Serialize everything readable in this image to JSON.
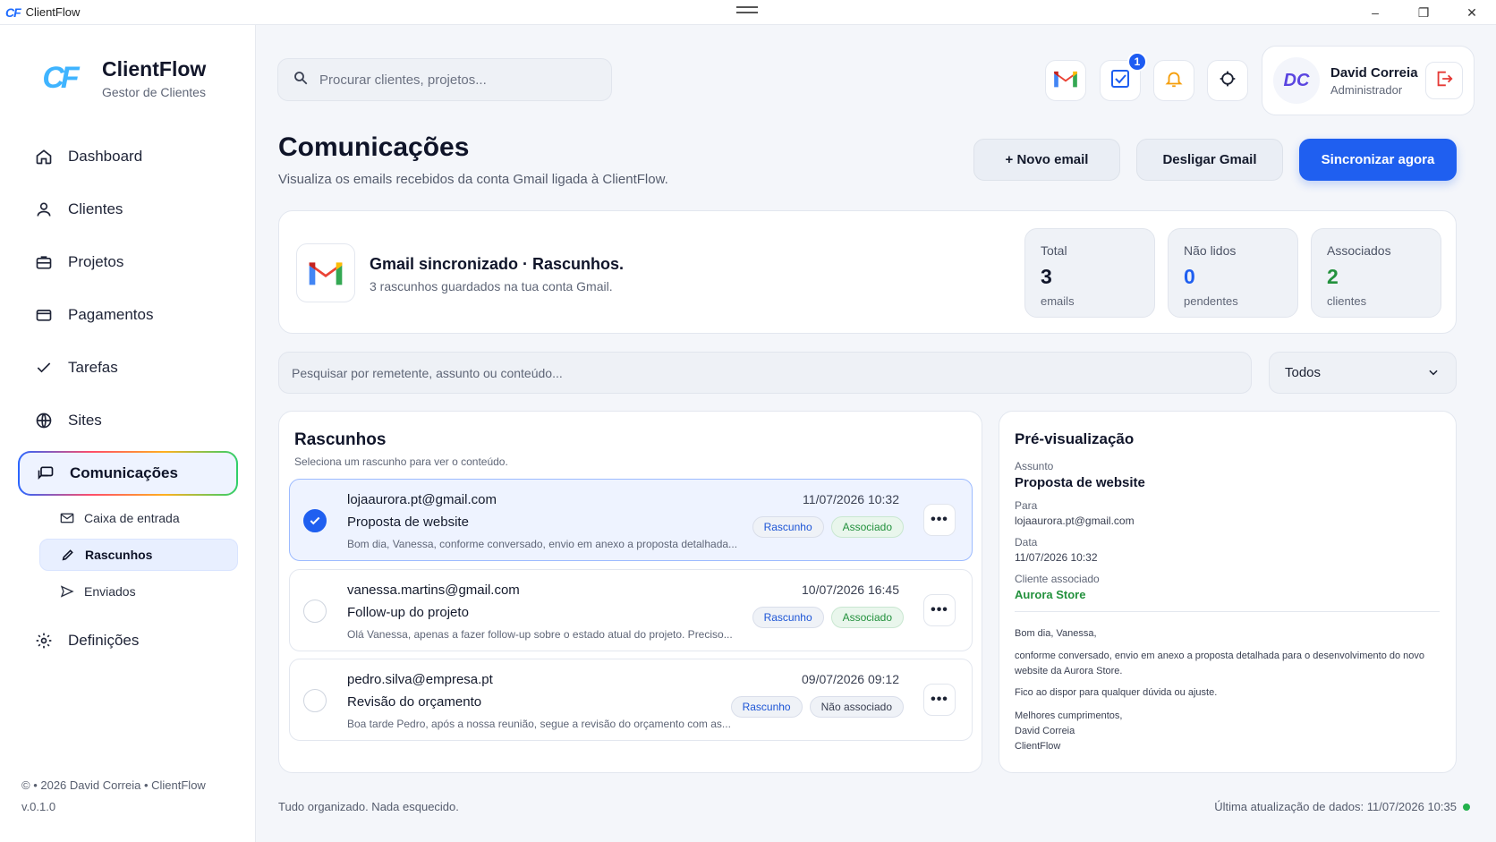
{
  "window": {
    "title": "ClientFlow",
    "logo_mark": "CF",
    "controls": {
      "minimize": "–",
      "maximize": "❐",
      "close": "✕"
    }
  },
  "brand": {
    "mark": "CF",
    "name": "ClientFlow",
    "subtitle": "Gestor de Clientes"
  },
  "sidebar": {
    "items": [
      {
        "label": "Dashboard",
        "icon": "home-icon"
      },
      {
        "label": "Clientes",
        "icon": "user-icon"
      },
      {
        "label": "Projetos",
        "icon": "briefcase-icon"
      },
      {
        "label": "Pagamentos",
        "icon": "wallet-icon"
      },
      {
        "label": "Tarefas",
        "icon": "check-icon"
      },
      {
        "label": "Sites",
        "icon": "globe-icon"
      },
      {
        "label": "Comunicações",
        "icon": "chat-icon",
        "active": true
      },
      {
        "label": "Definições",
        "icon": "gear-icon"
      }
    ],
    "subitems": [
      {
        "label": "Caixa de entrada",
        "icon": "mail-icon"
      },
      {
        "label": "Rascunhos",
        "icon": "pencil-icon",
        "active": true
      },
      {
        "label": "Enviados",
        "icon": "send-icon"
      }
    ],
    "copyright": "© • 2026 David Correia • ClientFlow",
    "version": "v.0.1.0"
  },
  "header": {
    "search_placeholder": "Procurar clientes, projetos...",
    "tasks_badge": "1",
    "user": {
      "initials": "DC",
      "name": "David Correia",
      "role": "Administrador"
    }
  },
  "page": {
    "title": "Comunicações",
    "subtitle": "Visualiza os emails recebidos da conta Gmail ligada à ClientFlow.",
    "actions": {
      "new_email": "+ Novo email",
      "disconnect": "Desligar Gmail",
      "sync": "Sincronizar agora"
    }
  },
  "sync": {
    "title": "Gmail sincronizado · Rascunhos.",
    "subtitle": "3 rascunhos guardados na tua conta Gmail.",
    "stats": [
      {
        "label": "Total",
        "value": "3",
        "unit": "emails",
        "color": "#10152a"
      },
      {
        "label": "Não lidos",
        "value": "0",
        "unit": "pendentes",
        "color": "#1f5ff0"
      },
      {
        "label": "Associados",
        "value": "2",
        "unit": "clientes",
        "color": "#23913d"
      }
    ]
  },
  "filter": {
    "placeholder": "Pesquisar por remetente, assunto ou conteúdo...",
    "select_value": "Todos"
  },
  "drafts": {
    "title": "Rascunhos",
    "subtitle": "Seleciona um rascunho para ver o conteúdo.",
    "rows": [
      {
        "from": "lojaaurora.pt@gmail.com",
        "subject": "Proposta de website",
        "preview": "Bom dia, Vanessa, conforme conversado, envio em anexo a proposta detalhada...",
        "date": "11/07/2026 10:32",
        "tag1": "Rascunho",
        "tag2": "Associado",
        "selected": true
      },
      {
        "from": "vanessa.martins@gmail.com",
        "subject": "Follow-up do projeto",
        "preview": "Olá Vanessa, apenas a fazer follow-up sobre o estado atual do projeto. Preciso...",
        "date": "10/07/2026 16:45",
        "tag1": "Rascunho",
        "tag2": "Associado",
        "selected": false
      },
      {
        "from": "pedro.silva@empresa.pt",
        "subject": "Revisão do orçamento",
        "preview": "Boa tarde Pedro, após a nossa reunião, segue a revisão do orçamento com as...",
        "date": "09/07/2026 09:12",
        "tag1": "Rascunho",
        "tag2": "Não associado",
        "selected": false
      }
    ]
  },
  "preview": {
    "title": "Pré-visualização",
    "subject_label": "Assunto",
    "subject": "Proposta de website",
    "to_label": "Para",
    "to": "lojaaurora.pt@gmail.com",
    "date_label": "Data",
    "date": "11/07/2026 10:32",
    "client_label": "Cliente associado",
    "client": "Aurora Store",
    "greeting": "Bom dia, Vanessa,",
    "body1": "conforme conversado, envio em anexo a proposta detalhada para o desenvolvimento do novo website da Aurora Store.",
    "body2": "Fico ao dispor para qualquer dúvida ou ajuste.",
    "signoff": "Melhores cumprimentos,",
    "sig_name": "David Correia",
    "sig_company": "ClientFlow"
  },
  "footer": {
    "left": "Tudo organizado. Nada esquecido.",
    "right": "Última atualização de dados: 11/07/2026 10:35"
  },
  "colors": {
    "accent": "#1f5ff0",
    "success": "#23913d",
    "bell": "#f59e0b",
    "danger": "#e53935"
  }
}
